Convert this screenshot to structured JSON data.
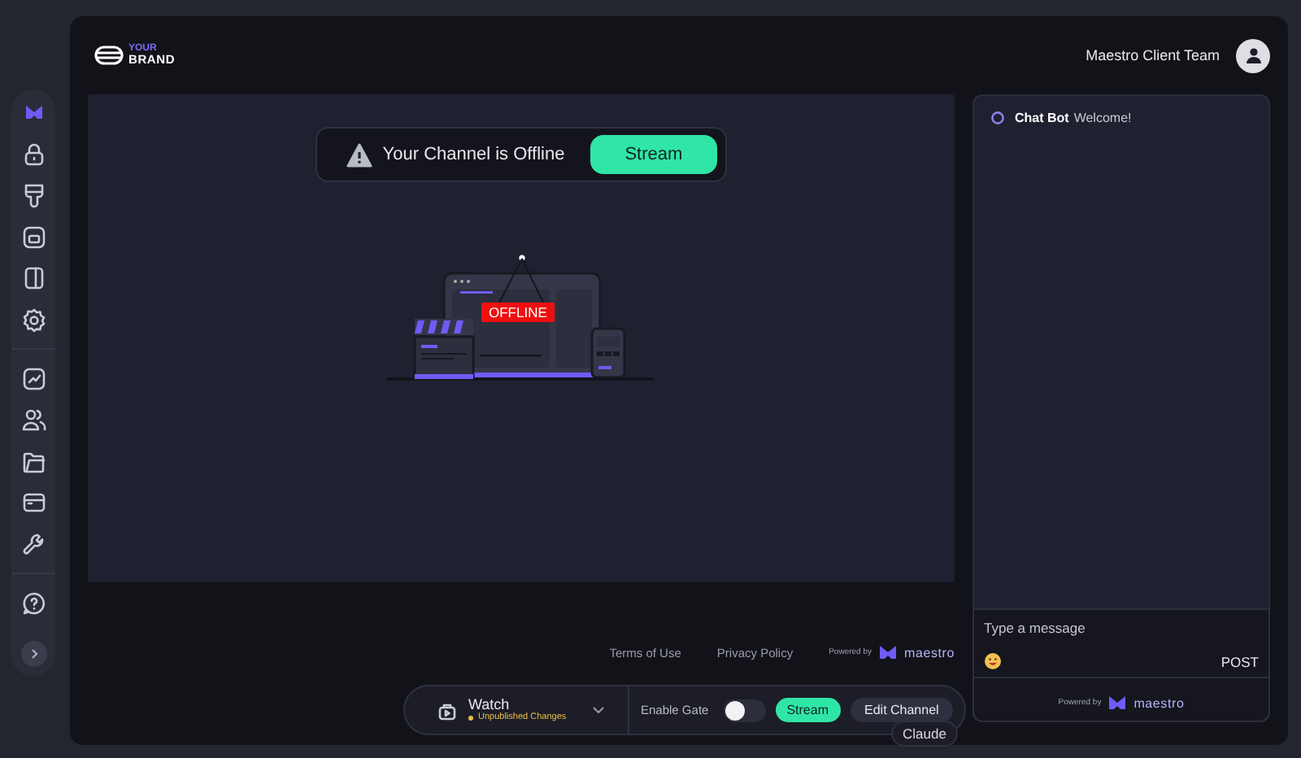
{
  "brand": {
    "tag": "YOUR",
    "name": "BRAND"
  },
  "header": {
    "team_name": "Maestro Client Team"
  },
  "banner": {
    "message": "Your Channel is Offline",
    "button": "Stream"
  },
  "illustration": {
    "badge": "OFFLINE"
  },
  "footer": {
    "links": [
      "Terms of Use",
      "Privacy Policy"
    ],
    "powered_by": "Powered by",
    "logo_text": "maestro"
  },
  "chat": {
    "messages": [
      {
        "author": "Chat Bot",
        "text": "Welcome!"
      }
    ],
    "input": {
      "placeholder": "Type a message"
    },
    "post_button": "POST",
    "powered_by": "Powered by",
    "logo_text": "maestro"
  },
  "toolbar": {
    "mode": "Watch",
    "notice": "Unpublished Changes",
    "gate_label": "Enable Gate",
    "gate_on": false,
    "stream_button": "Stream",
    "edit_button": "Edit Channel"
  },
  "tooltip": {
    "text": "Claude"
  }
}
